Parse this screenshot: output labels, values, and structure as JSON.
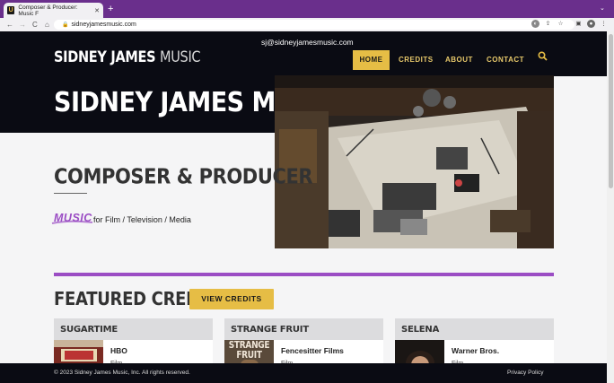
{
  "browser": {
    "tab_title": "Composer & Producer: Music F",
    "tab_close": "✕",
    "new_tab": "+",
    "url": "sidneyjamesmusic.com",
    "back": "←",
    "forward": "→",
    "reload": "C",
    "home": "⌂"
  },
  "header": {
    "email": "sj@sidneyjamesmusic.com",
    "logo_bold": "SIDNEY JAMES ",
    "logo_light": "MUSIC",
    "nav": [
      "HOME",
      "CREDITS",
      "ABOUT",
      "CONTACT"
    ],
    "active_nav": "HOME"
  },
  "hero": {
    "title": "SIDNEY JAMES MUSIC",
    "subtitle": "COMPOSER & PRODUCER",
    "music_word": "MUSIC",
    "music_rest": "for Film / Television / Media"
  },
  "featured": {
    "title": "FEATURED CREDITS",
    "button": "VIEW CREDITS",
    "cards": [
      {
        "title": "SUGARTIME",
        "studio": "HBO",
        "type": "Film",
        "thumb_text": ""
      },
      {
        "title": "STRANGE FRUIT",
        "studio": "Fencesitter Films",
        "type": "Film",
        "thumb_text": "STRANGE FRUIT"
      },
      {
        "title": "SELENA",
        "studio": "Warner Bros.",
        "type": "Film",
        "thumb_text": ""
      }
    ]
  },
  "footer": {
    "copyright": "© 2023 Sidney James Music, Inc. All rights reserved.",
    "privacy": "Privacy Policy"
  },
  "colors": {
    "accent_purple": "#9b4dc4",
    "accent_gold": "#e6bd45",
    "dark": "#0a0b13",
    "chrome_purple": "#6a2f8c"
  }
}
